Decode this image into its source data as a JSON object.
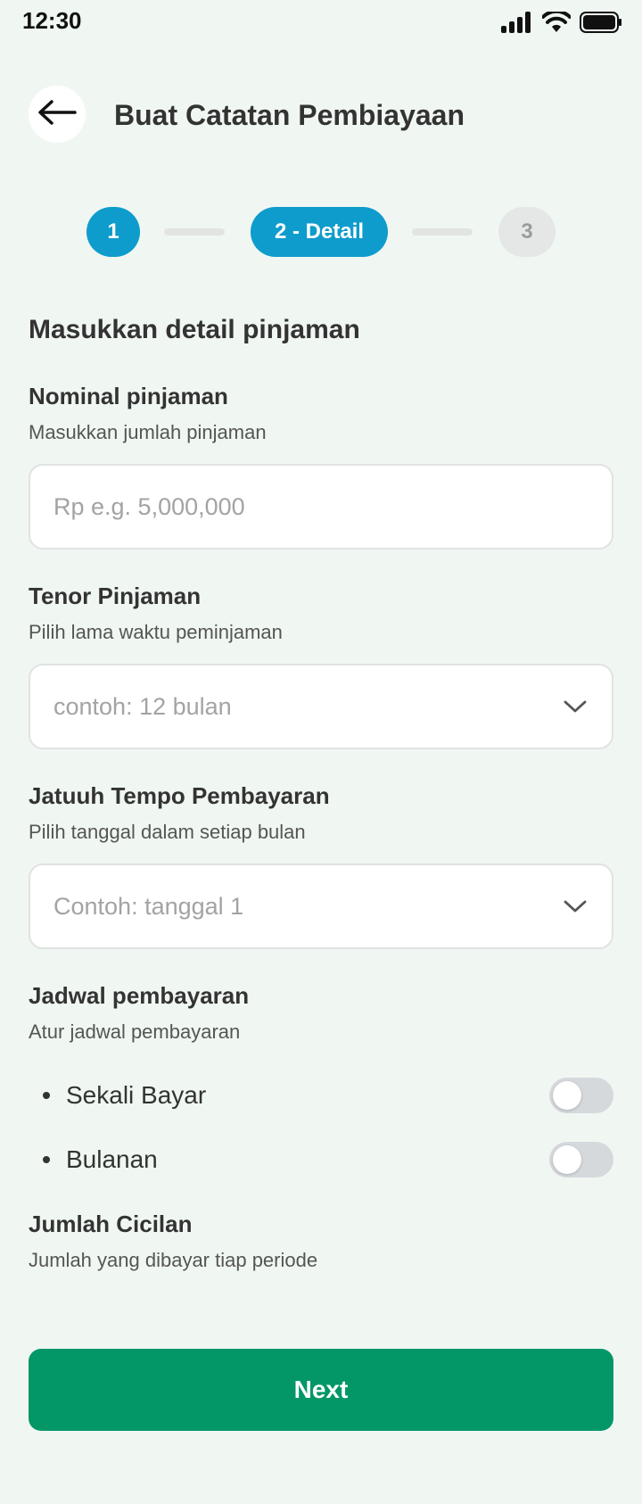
{
  "status_bar": {
    "time": "12:30"
  },
  "header": {
    "title": "Buat Catatan Pembiayaan"
  },
  "stepper": {
    "steps": [
      {
        "label": "1",
        "state": "active"
      },
      {
        "label": "2 - Detail",
        "state": "active"
      },
      {
        "label": "3",
        "state": "inactive"
      }
    ]
  },
  "form": {
    "section_title": "Masukkan detail pinjaman",
    "nominal": {
      "label": "Nominal pinjaman",
      "help": "Masukkan jumlah pinjaman",
      "placeholder": "Rp e.g. 5,000,000"
    },
    "tenor": {
      "label": "Tenor Pinjaman",
      "help": "Pilih lama waktu peminjaman",
      "placeholder": "contoh: 12 bulan"
    },
    "due_date": {
      "label": "Jatuuh Tempo Pembayaran",
      "help": "Pilih tanggal dalam setiap bulan",
      "placeholder": "Contoh: tanggal 1"
    },
    "schedule": {
      "label": "Jadwal pembayaran",
      "help": "Atur jadwal pembayaran",
      "options": [
        {
          "label": "Sekali Bayar",
          "enabled": false
        },
        {
          "label": "Bulanan",
          "enabled": false
        }
      ]
    },
    "installment": {
      "label": "Jumlah Cicilan",
      "help": "Jumlah yang dibayar tiap periode"
    }
  },
  "actions": {
    "next_label": "Next"
  },
  "colors": {
    "background": "#f0f7f2",
    "step_active": "#0e9ccc",
    "primary_button": "#039767",
    "toggle_off": "#d6d9dc"
  }
}
